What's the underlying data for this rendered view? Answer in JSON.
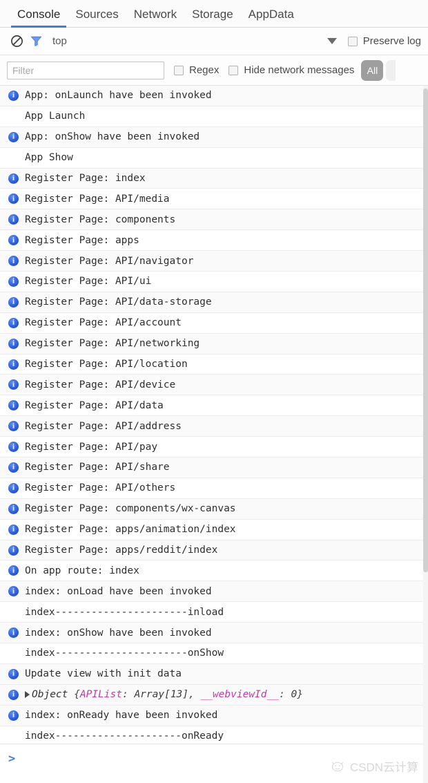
{
  "tabs": [
    {
      "label": "Console",
      "active": true
    },
    {
      "label": "Sources",
      "active": false
    },
    {
      "label": "Network",
      "active": false
    },
    {
      "label": "Storage",
      "active": false
    },
    {
      "label": "AppData",
      "active": false
    }
  ],
  "toolbar": {
    "clear_icon": "clear-console-icon",
    "filter_icon": "funnel-filter-icon",
    "context_label": "top",
    "context_caret_icon": "chevron-down-icon",
    "preserve_log_label": "Preserve log",
    "preserve_log_checked": false
  },
  "filterbar": {
    "filter_placeholder": "Filter",
    "filter_value": "",
    "regex_label": "Regex",
    "regex_checked": false,
    "hide_network_label": "Hide network messages",
    "hide_network_checked": false,
    "level_pill_label": "All"
  },
  "console": {
    "rows": [
      {
        "icon": "info",
        "text": "App: onLaunch have been invoked"
      },
      {
        "icon": "none",
        "text": "App Launch"
      },
      {
        "icon": "info",
        "text": "App: onShow have been invoked"
      },
      {
        "icon": "none",
        "text": "App Show"
      },
      {
        "icon": "info",
        "text": "Register Page: index"
      },
      {
        "icon": "info",
        "text": "Register Page: API/media"
      },
      {
        "icon": "info",
        "text": "Register Page: components"
      },
      {
        "icon": "info",
        "text": "Register Page: apps"
      },
      {
        "icon": "info",
        "text": "Register Page: API/navigator"
      },
      {
        "icon": "info",
        "text": "Register Page: API/ui"
      },
      {
        "icon": "info",
        "text": "Register Page: API/data-storage"
      },
      {
        "icon": "info",
        "text": "Register Page: API/account"
      },
      {
        "icon": "info",
        "text": "Register Page: API/networking"
      },
      {
        "icon": "info",
        "text": "Register Page: API/location"
      },
      {
        "icon": "info",
        "text": "Register Page: API/device"
      },
      {
        "icon": "info",
        "text": "Register Page: API/data"
      },
      {
        "icon": "info",
        "text": "Register Page: API/address"
      },
      {
        "icon": "info",
        "text": "Register Page: API/pay"
      },
      {
        "icon": "info",
        "text": "Register Page: API/share"
      },
      {
        "icon": "info",
        "text": "Register Page: API/others"
      },
      {
        "icon": "info",
        "text": "Register Page: components/wx-canvas"
      },
      {
        "icon": "info",
        "text": "Register Page: apps/animation/index"
      },
      {
        "icon": "info",
        "text": "Register Page: apps/reddit/index"
      },
      {
        "icon": "info",
        "text": "On app route: index"
      },
      {
        "icon": "info",
        "text": "index: onLoad have been invoked"
      },
      {
        "icon": "none",
        "text": "index----------------------inload"
      },
      {
        "icon": "info",
        "text": "index: onShow have been invoked"
      },
      {
        "icon": "none",
        "text": "index----------------------onShow"
      },
      {
        "icon": "info",
        "text": "Update view with init data"
      }
    ],
    "object_row": {
      "icon": "info",
      "disclosure_icon": "disclosure-triangle-right-icon",
      "type_label": "Object",
      "open_brace": "{",
      "prop1_name": "APIList",
      "prop1_value": "Array[13]",
      "separator": ", ",
      "prop2_name": "__webviewId__",
      "prop2_value": "0",
      "colon": ": ",
      "close_brace": "}"
    },
    "rows_after": [
      {
        "icon": "info",
        "text": "index: onReady have been invoked"
      },
      {
        "icon": "none",
        "text": "index---------------------onReady"
      }
    ]
  },
  "prompt": {
    "chevron": ">",
    "value": ""
  },
  "watermark": {
    "text": "CSDN云计算"
  }
}
